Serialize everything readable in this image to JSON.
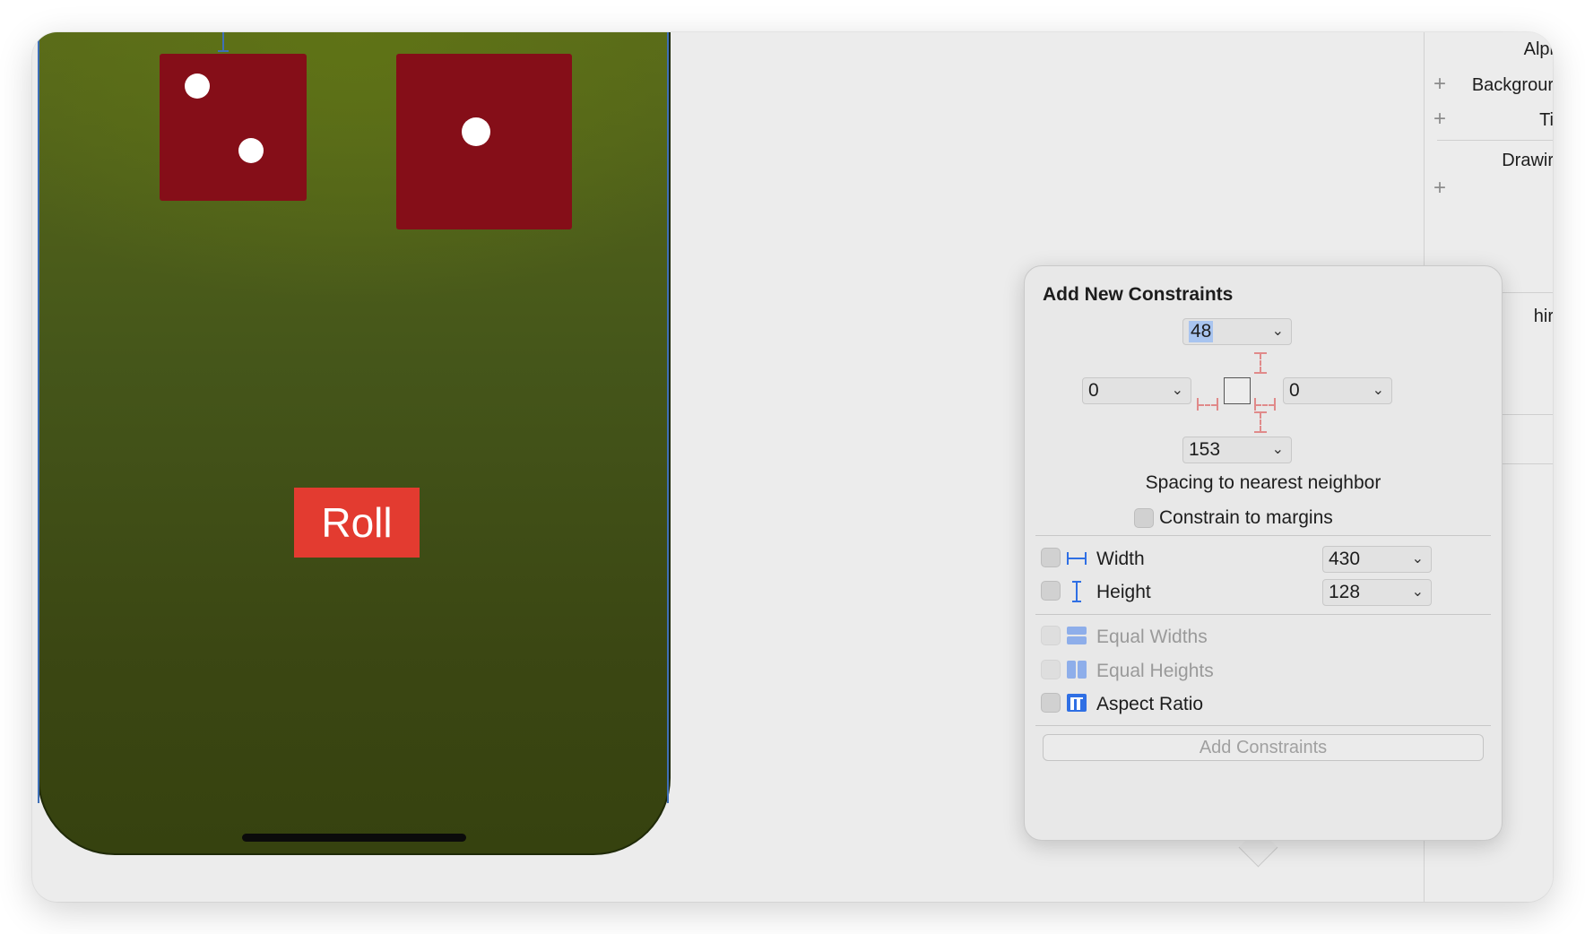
{
  "canvas": {
    "roll_button_label": "Roll",
    "dice": [
      {
        "name": "dice-two",
        "pips": 2
      },
      {
        "name": "dice-one",
        "pips": 1
      }
    ],
    "background_color": "#4a5a17",
    "dice_color": "#850e18",
    "roll_button_color": "#e33b30"
  },
  "inspector": {
    "labels": [
      "Alpi",
      "Backgrour",
      "Ti",
      "Drawir",
      "hir"
    ]
  },
  "popover": {
    "title": "Add New Constraints",
    "top_value": "48",
    "left_value": "0",
    "right_value": "0",
    "bottom_value": "153",
    "spacing_label": "Spacing to nearest neighbor",
    "constrain_margins_label": "Constrain to margins",
    "width_label": "Width",
    "width_value": "430",
    "height_label": "Height",
    "height_value": "128",
    "equal_widths_label": "Equal Widths",
    "equal_heights_label": "Equal Heights",
    "aspect_ratio_label": "Aspect Ratio",
    "add_button_label": "Add Constraints",
    "accent_color": "#2f6fe4"
  }
}
